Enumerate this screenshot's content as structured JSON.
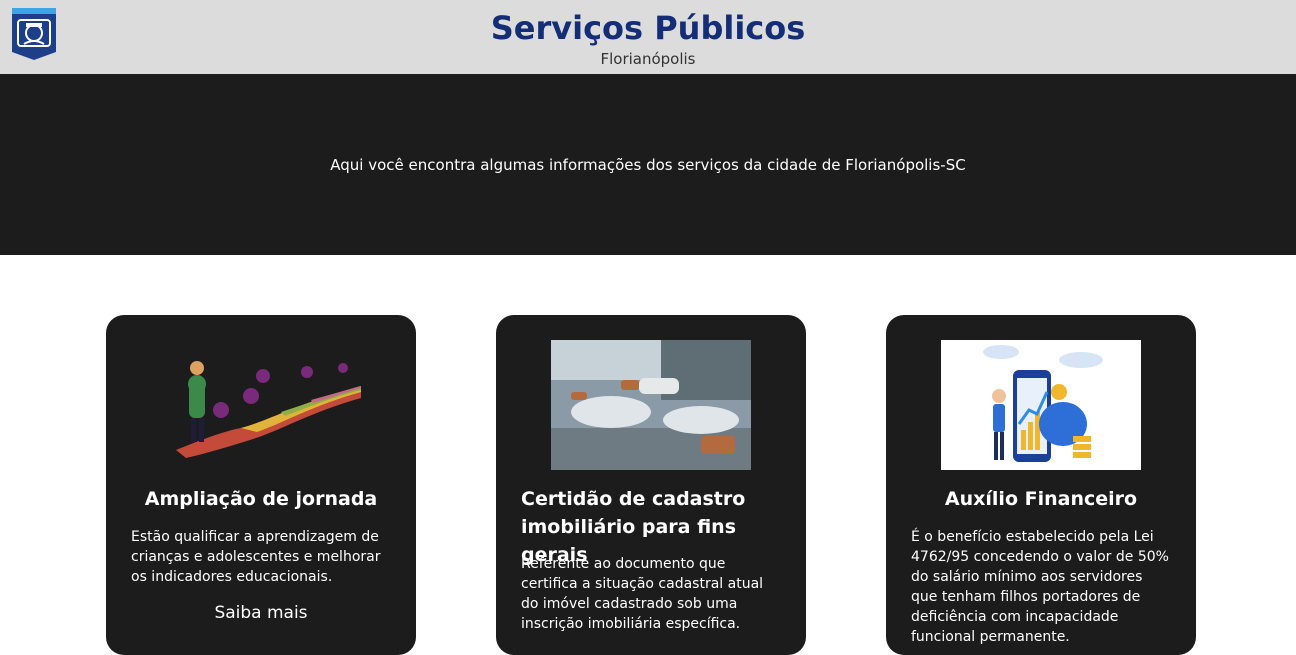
{
  "header": {
    "title": "Serviços Públicos",
    "subtitle": "Florianópolis",
    "logo_icon": "city-coat-of-arms-icon"
  },
  "hero": {
    "text": "Aqui você encontra algumas informações dos serviços da cidade de Florianópolis-SC"
  },
  "cards": [
    {
      "title": "Ampliação de jornada",
      "text": "Estão qualificar a aprendizagem de crianças e adolescentes e melhorar os indicadores educacionais.",
      "link": "Saiba mais",
      "image_icon": "learning-path-illustration"
    },
    {
      "title": "Certidão de cadastro imobiliário para fins gerais",
      "text": "Referente ao documento que certifica a situação cadastral atual do imóvel cadastrado sob uma inscrição imobiliária específica.",
      "image_icon": "lounge-interior-photo"
    },
    {
      "title": "Auxílio Financeiro",
      "text": "É o benefício estabelecido pela Lei 4762/95 concedendo o valor de 50% do salário mínimo aos servidores que tenham filhos portadores de deficiência com incapacidade funcional permanente.",
      "image_icon": "financial-growth-illustration"
    }
  ],
  "colors": {
    "header_bg": "#dcdcdc",
    "title": "#142d77",
    "dark": "#1c1c1c"
  }
}
